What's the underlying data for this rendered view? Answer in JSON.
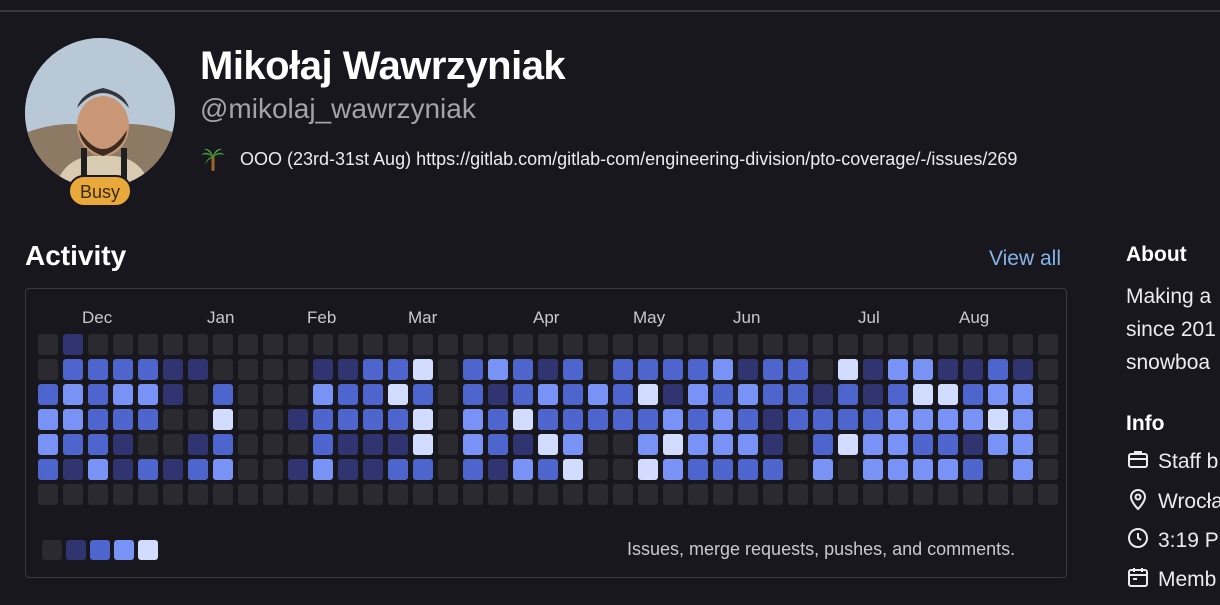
{
  "profile": {
    "name": "Mikołaj Wawrzyniak",
    "handle": "@mikolaj_wawrzyniak",
    "availability": "Busy",
    "status_emoji": "palm-tree-icon",
    "status_message": "OOO (23rd-31st Aug) https://gitlab.com/gitlab-com/engineering-division/pto-coverage/-/issues/269"
  },
  "activity": {
    "title": "Activity",
    "view_all": "View all",
    "months": [
      "Dec",
      "Jan",
      "Feb",
      "Mar",
      "Apr",
      "May",
      "Jun",
      "Jul",
      "Aug"
    ],
    "legend_text": "Issues, merge requests, pushes, and comments.",
    "level_colors": [
      "#2b2a31",
      "#303470",
      "#4e65cd",
      "#7992f5",
      "#d2dcff"
    ],
    "weeks": [
      [
        0,
        0,
        2,
        3,
        3,
        2,
        0
      ],
      [
        1,
        2,
        3,
        3,
        2,
        1,
        0
      ],
      [
        0,
        2,
        2,
        2,
        2,
        3,
        0
      ],
      [
        0,
        2,
        3,
        2,
        1,
        1,
        0
      ],
      [
        0,
        2,
        3,
        2,
        0,
        2,
        0
      ],
      [
        0,
        1,
        1,
        0,
        0,
        1,
        0
      ],
      [
        0,
        1,
        0,
        0,
        1,
        2,
        0
      ],
      [
        0,
        0,
        2,
        4,
        2,
        3,
        0
      ],
      [
        0,
        0,
        0,
        0,
        0,
        0,
        0
      ],
      [
        0,
        0,
        0,
        0,
        0,
        0,
        0
      ],
      [
        0,
        0,
        0,
        1,
        0,
        1,
        0
      ],
      [
        0,
        1,
        3,
        2,
        2,
        3,
        0
      ],
      [
        0,
        1,
        2,
        2,
        1,
        1,
        0
      ],
      [
        0,
        2,
        2,
        2,
        1,
        1,
        0
      ],
      [
        0,
        2,
        4,
        2,
        1,
        2,
        0
      ],
      [
        0,
        4,
        2,
        4,
        4,
        2,
        0
      ],
      [
        0,
        0,
        0,
        0,
        0,
        0,
        0
      ],
      [
        0,
        2,
        2,
        3,
        3,
        2,
        0
      ],
      [
        0,
        3,
        1,
        2,
        2,
        1,
        0
      ],
      [
        0,
        2,
        2,
        4,
        1,
        3,
        0
      ],
      [
        0,
        1,
        3,
        2,
        4,
        2,
        0
      ],
      [
        0,
        2,
        2,
        2,
        3,
        4,
        0
      ],
      [
        0,
        0,
        3,
        2,
        0,
        0,
        0
      ],
      [
        0,
        2,
        2,
        2,
        0,
        0,
        0
      ],
      [
        0,
        2,
        4,
        2,
        3,
        4,
        0
      ],
      [
        0,
        2,
        1,
        3,
        4,
        3,
        0
      ],
      [
        0,
        2,
        3,
        2,
        3,
        2,
        0
      ],
      [
        0,
        3,
        2,
        3,
        3,
        2,
        0
      ],
      [
        0,
        1,
        3,
        2,
        3,
        2,
        0
      ],
      [
        0,
        2,
        2,
        1,
        1,
        2,
        0
      ],
      [
        0,
        2,
        2,
        2,
        0,
        0,
        0
      ],
      [
        0,
        0,
        1,
        2,
        2,
        3,
        0
      ],
      [
        0,
        4,
        2,
        2,
        4,
        0,
        0
      ],
      [
        0,
        1,
        1,
        2,
        3,
        3,
        0
      ],
      [
        0,
        3,
        2,
        3,
        3,
        3,
        0
      ],
      [
        0,
        3,
        4,
        3,
        2,
        3,
        0
      ],
      [
        0,
        1,
        4,
        3,
        2,
        3,
        0
      ],
      [
        0,
        1,
        2,
        3,
        1,
        2,
        0
      ],
      [
        0,
        2,
        3,
        4,
        3,
        0,
        0
      ],
      [
        0,
        1,
        3,
        3,
        3,
        3,
        0
      ],
      [
        0,
        0,
        0,
        0,
        0,
        0,
        0
      ]
    ]
  },
  "about": {
    "title": "About",
    "lines": [
      "Making a",
      "since 201",
      "snowboa"
    ]
  },
  "info": {
    "title": "Info",
    "rows": [
      {
        "icon": "briefcase-icon",
        "text": "Staff b"
      },
      {
        "icon": "location-icon",
        "text": "Wrocła"
      },
      {
        "icon": "clock-icon",
        "text": "3:19 P"
      },
      {
        "icon": "calendar-icon",
        "text": "Memb"
      }
    ]
  }
}
